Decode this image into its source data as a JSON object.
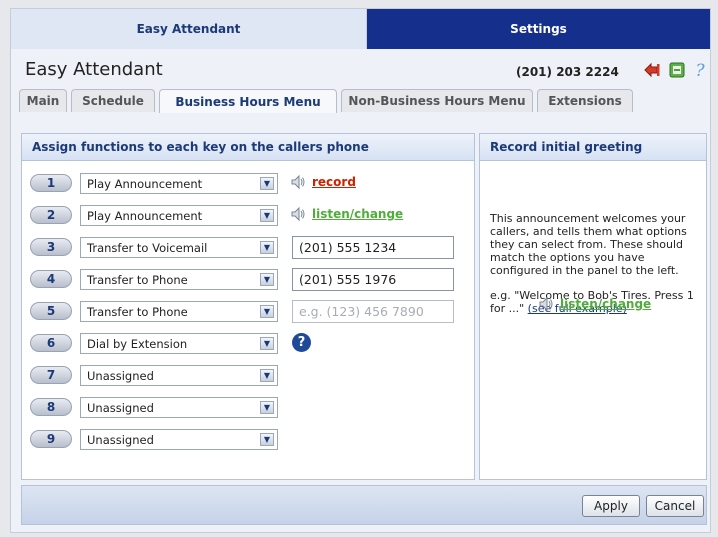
{
  "tabs": [
    {
      "label": "Easy Attendant"
    },
    {
      "label": "Settings"
    }
  ],
  "header": {
    "title": "Easy Attendant",
    "phone": "(201) 203 2224"
  },
  "subtabs": [
    {
      "label": "Main"
    },
    {
      "label": "Schedule"
    },
    {
      "label": "Business Hours Menu"
    },
    {
      "label": "Non-Business Hours Menu"
    },
    {
      "label": "Extensions"
    }
  ],
  "left_panel": {
    "title": "Assign functions to each key on the callers phone",
    "rows": [
      {
        "key": "1",
        "function": "Play Announcement",
        "action": "record"
      },
      {
        "key": "2",
        "function": "Play Announcement",
        "action": "listen/change"
      },
      {
        "key": "3",
        "function": "Transfer to Voicemail",
        "value": "(201) 555 1234"
      },
      {
        "key": "4",
        "function": "Transfer to Phone",
        "value": "(201) 555 1976"
      },
      {
        "key": "5",
        "function": "Transfer to Phone",
        "placeholder": "e.g. (123) 456 7890"
      },
      {
        "key": "6",
        "function": "Dial by Extension",
        "help": "?"
      },
      {
        "key": "7",
        "function": "Unassigned"
      },
      {
        "key": "8",
        "function": "Unassigned"
      },
      {
        "key": "9",
        "function": "Unassigned"
      }
    ]
  },
  "right_panel": {
    "title": "Record initial greeting",
    "description": "This announcement welcomes your callers, and tells them what options they can select from. These should match the options you have configured in the panel to the left.",
    "example_text": "e.g. \"Welcome to Bob's Tires. Press 1 for ...\"",
    "example_link": "(see full example)",
    "listen_link": "listen/change"
  },
  "footer": {
    "apply": "Apply",
    "cancel": "Cancel"
  },
  "colors": {
    "nav_active": "#142f8c",
    "heading": "#1c3a78",
    "record_link": "#cc2200",
    "listen_link": "#4fae3a"
  },
  "icons": [
    "logout-icon",
    "export-icon",
    "help-icon",
    "speaker-icon",
    "question-icon",
    "chevron-down-icon"
  ]
}
